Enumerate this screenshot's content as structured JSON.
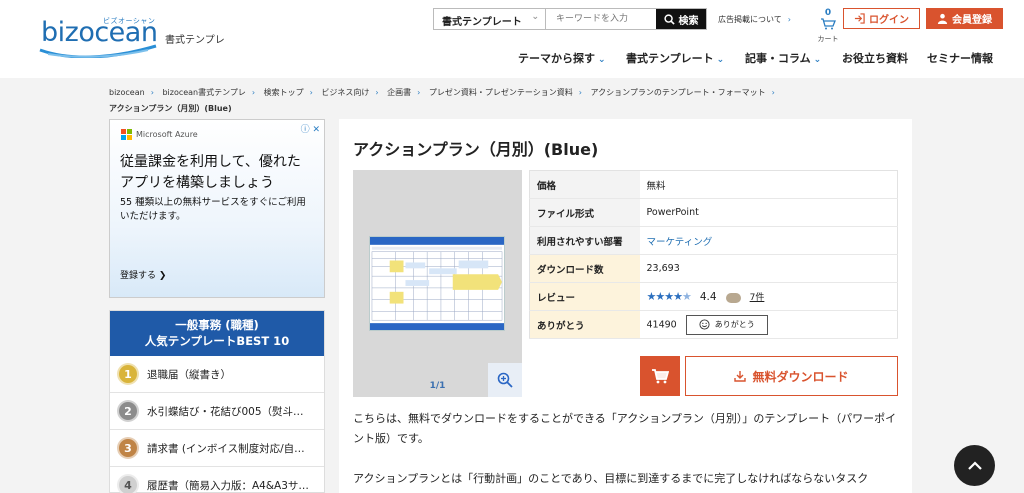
{
  "header": {
    "logo_text": "bizocean",
    "logo_kana": "ビズオーシャン",
    "tagline": "書式テンプレ",
    "search": {
      "category": "書式テンプレート",
      "placeholder": "キーワードを入力",
      "button": "検索"
    },
    "ad_link": "広告掲載について",
    "cart_count": "0",
    "cart_label": "カート",
    "login": "ログイン",
    "register": "会員登録",
    "brand_color": "#d9532e"
  },
  "nav": [
    {
      "label": "テーマから探す",
      "has_dropdown": true
    },
    {
      "label": "書式テンプレート",
      "has_dropdown": true
    },
    {
      "label": "記事・コラム",
      "has_dropdown": true
    },
    {
      "label": "お役立ち資料",
      "has_dropdown": false
    },
    {
      "label": "セミナー情報",
      "has_dropdown": false
    }
  ],
  "breadcrumb": [
    "bizocean",
    "bizocean書式テンプレ",
    "検索トップ",
    "ビジネス向け",
    "企画書",
    "プレゼン資料・プレゼンテーション資料",
    "アクションプランのテンプレート・フォーマット"
  ],
  "breadcrumb_current": "アクションプラン（月別）(Blue)",
  "ad": {
    "brand": "Microsoft Azure",
    "headline": "従量課金を利用して、優れたアプリを構築しましょう",
    "sub": "55 種類以上の無料サービスをすぐにご利用いただけます。",
    "cta": "登録する ❯"
  },
  "ranking": {
    "title_line1": "一般事務 (職種)",
    "title_line2": "人気テンプレートBEST 10",
    "items": [
      {
        "rank": "1",
        "label": "退職届（縦書き）",
        "color": "#d9b43a"
      },
      {
        "rank": "2",
        "label": "水引蝶結び・花結び005（熨斗…",
        "color": "#8c8c8c"
      },
      {
        "rank": "3",
        "label": "請求書 (インボイス制度対応/自…",
        "color": "#c08446"
      },
      {
        "rank": "4",
        "label": "履歴書（簡易入力版：A4&A3サ…",
        "color": "#d0d0d0"
      }
    ]
  },
  "product": {
    "title": "アクションプラン（月別）(Blue)",
    "pager": "1/1",
    "info": {
      "price_label": "価格",
      "price": "無料",
      "format_label": "ファイル形式",
      "format": "PowerPoint",
      "dept_label": "利用されやすい部署",
      "dept": "マーケティング",
      "downloads_label": "ダウンロード数",
      "downloads": "23,693",
      "review_label": "レビュー",
      "rating": "4.4",
      "rating_value": 4.4,
      "reviews_count": "7件",
      "thanks_label": "ありがとう",
      "thanks_count": "41490",
      "thanks_button": "ありがとう"
    },
    "download_button": "無料ダウンロード",
    "desc1": "こちらは、無料でダウンロードをすることができる「アクションプラン（月別）」のテンプレート（パワーポイント版）です。",
    "desc2": "アクションプランとは「行動計画」のことであり、目標に到達するまでに完了しなければならないタスク"
  }
}
